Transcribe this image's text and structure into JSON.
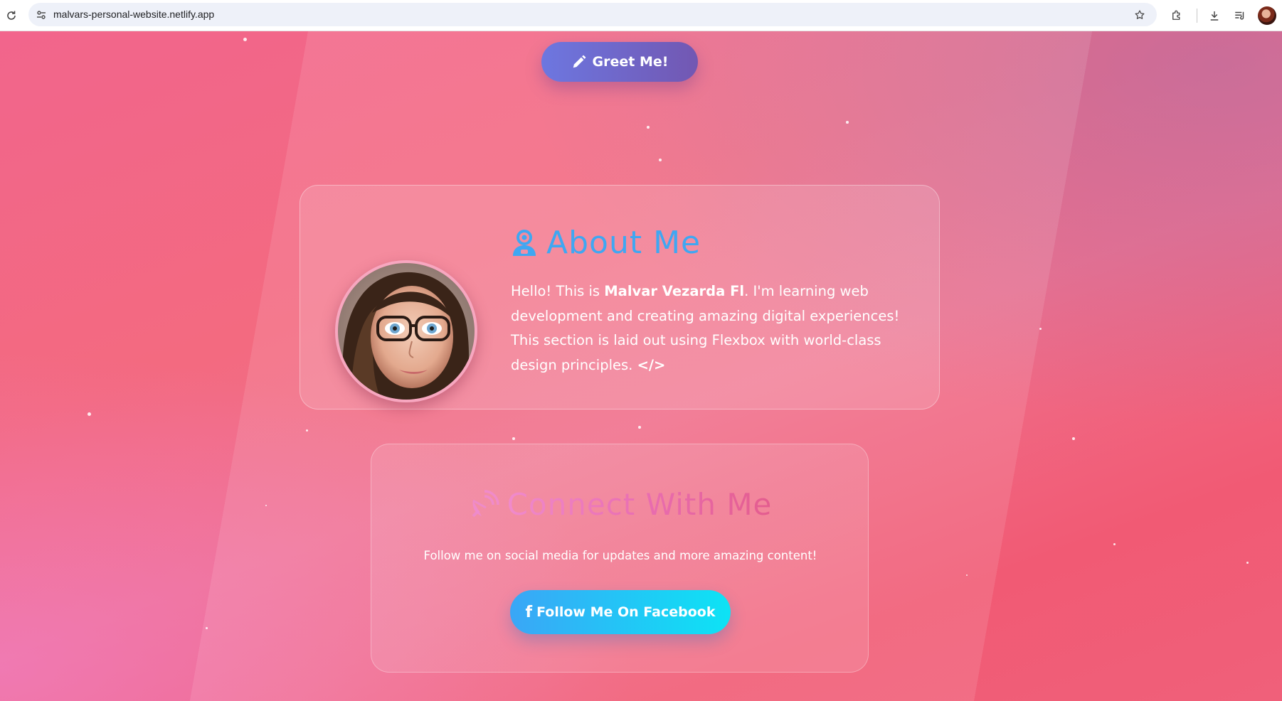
{
  "browser": {
    "url": "malvars-personal-website.netlify.app"
  },
  "page": {
    "greet_button": {
      "label": "Greet Me!",
      "icon": "pencil-icon"
    },
    "about": {
      "title": "About Me",
      "icon": "robot-icon",
      "text_before": "Hello! This is ",
      "name": "Malvar Vezarda Fl",
      "text_after": ". I'm learning web development and creating amazing digital experiences! This section is laid out using Flexbox with world-class design principles. ",
      "code_glyph": "</>",
      "photo": "profile-photo"
    },
    "connect": {
      "title": "Connect With Me",
      "icon": "satellite-dish-icon",
      "text": "Follow me on social media for updates and more amazing content!",
      "facebook_button": {
        "icon_glyph": "f",
        "label": "Follow Me On Facebook"
      }
    }
  },
  "colors": {
    "about_title": "#3fa7f2",
    "greet_button_start": "#6d77e0",
    "greet_button_end": "#7257b2",
    "facebook_button_start": "#3aa6f6",
    "facebook_button_end": "#0de3f5",
    "background": "#f2658c"
  }
}
